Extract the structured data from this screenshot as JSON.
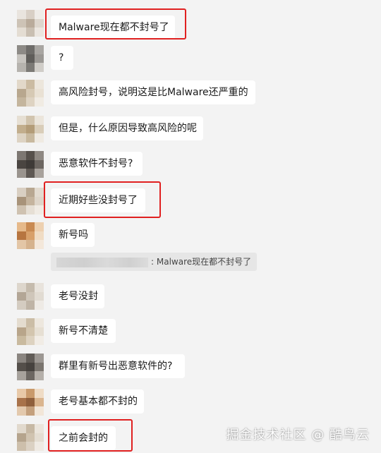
{
  "messages": [
    {
      "text": "Malware现在都不封号了",
      "highlighted": true
    },
    {
      "text": "?",
      "highlighted": false
    },
    {
      "text": "高风险封号，说明这是比Malware还严重的",
      "highlighted": false
    },
    {
      "text": "但是，什么原因导致高风险的呢",
      "highlighted": false
    },
    {
      "text": "恶意软件不封号?",
      "highlighted": false
    },
    {
      "text": "近期好些没封号了",
      "highlighted": true
    },
    {
      "text": "新号吗",
      "highlighted": false,
      "quote": ": Malware现在都不封号了"
    },
    {
      "text": "老号没封",
      "highlighted": false
    },
    {
      "text": "新号不清楚",
      "highlighted": false
    },
    {
      "text": "群里有新号出恶意软件的?",
      "highlighted": false
    },
    {
      "text": "老号基本都不封的",
      "highlighted": false
    },
    {
      "text": "之前会封的",
      "highlighted": true
    }
  ],
  "watermark": "掘金技术社区 @ 酷鸟云",
  "colors": {
    "highlight": "#e02020",
    "bubble": "#ffffff",
    "background": "#f3f3f3",
    "quote": "#e6e6e6"
  }
}
